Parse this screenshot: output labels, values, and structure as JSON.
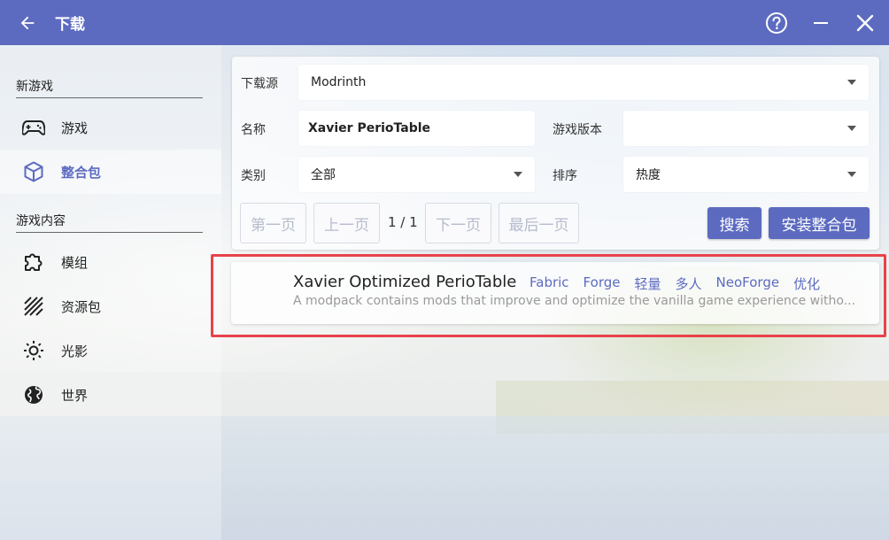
{
  "titlebar": {
    "title": "下载",
    "back_icon": "arrow-left-icon",
    "help_icon": "help-circle-icon",
    "minimize_icon": "minimize-icon",
    "close_icon": "close-icon",
    "color": "#5c6bc0"
  },
  "sidebar": {
    "section_new_game": "新游戏",
    "section_game_content": "游戏内容",
    "items": [
      {
        "label": "游戏",
        "icon": "gamepad-icon",
        "active": false
      },
      {
        "label": "整合包",
        "icon": "package-cube-icon",
        "active": true
      },
      {
        "label": "模组",
        "icon": "puzzle-icon",
        "active": false
      },
      {
        "label": "资源包",
        "icon": "texture-stripes-icon",
        "active": false
      },
      {
        "label": "光影",
        "icon": "sun-icon",
        "active": false
      },
      {
        "label": "世界",
        "icon": "globe-icon",
        "active": false
      }
    ]
  },
  "search": {
    "source_label": "下载源",
    "source_value": "Modrinth",
    "name_label": "名称",
    "name_value": "Xavier PerioTable",
    "version_label": "游戏版本",
    "version_value": "",
    "category_label": "类别",
    "category_value": "全部",
    "sort_label": "排序",
    "sort_value": "热度",
    "first_page": "第一页",
    "prev_page": "上一页",
    "page_info": "1 / 1",
    "next_page": "下一页",
    "last_page": "最后一页",
    "search_button": "搜索",
    "install_button": "安装整合包"
  },
  "results": [
    {
      "name": "Xavier Optimized PerioTable",
      "tags": [
        "Fabric",
        "Forge",
        "轻量",
        "多人",
        "NeoForge",
        "优化"
      ],
      "description": "A modpack contains mods that improve and optimize the vanilla game experience witho..."
    }
  ],
  "colors": {
    "accent": "#5c6bc0",
    "highlight": "#e8424a"
  }
}
